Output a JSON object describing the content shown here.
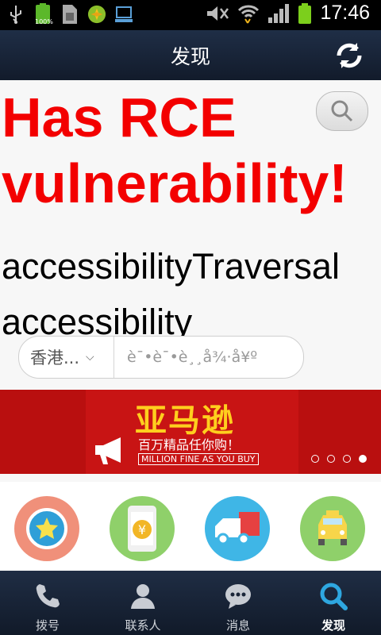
{
  "status_bar": {
    "time": "17:46",
    "battery_label": "100%",
    "icons": [
      "usb-icon",
      "battery-full-icon",
      "sim-icon",
      "game-icon",
      "computer-icon",
      "mute-icon",
      "wifi-icon",
      "signal-icon",
      "battery-icon"
    ]
  },
  "header": {
    "title": "发现"
  },
  "content": {
    "alert_text": "Has RCE vulnerability!",
    "accessibility_text": "accessibilityTraversal accessibility",
    "search": {
      "region": "香港...",
      "placeholder": "è¯•è¯•è¸¸å¾·å¥º"
    }
  },
  "banner": {
    "title": "亚马逊",
    "subtitle": "百万精品任你购！",
    "english": "MILLION FINE AS YOU BUY",
    "dots_count": 4,
    "active_dot": 4
  },
  "features": [
    {
      "name": "star",
      "color": "#f0907a"
    },
    {
      "name": "yuan",
      "color": "#8fd06a"
    },
    {
      "name": "truck",
      "color": "#3fb6e6"
    },
    {
      "name": "taxi",
      "color": "#8fd06a"
    }
  ],
  "tabs": [
    {
      "label": "拨号",
      "icon": "phone-icon"
    },
    {
      "label": "联系人",
      "icon": "contacts-icon"
    },
    {
      "label": "消息",
      "icon": "message-icon"
    },
    {
      "label": "发现",
      "icon": "search-icon"
    }
  ],
  "colors": {
    "accent": "#2ea7e0",
    "alert": "#f30000",
    "banner": "#b90f0f"
  }
}
